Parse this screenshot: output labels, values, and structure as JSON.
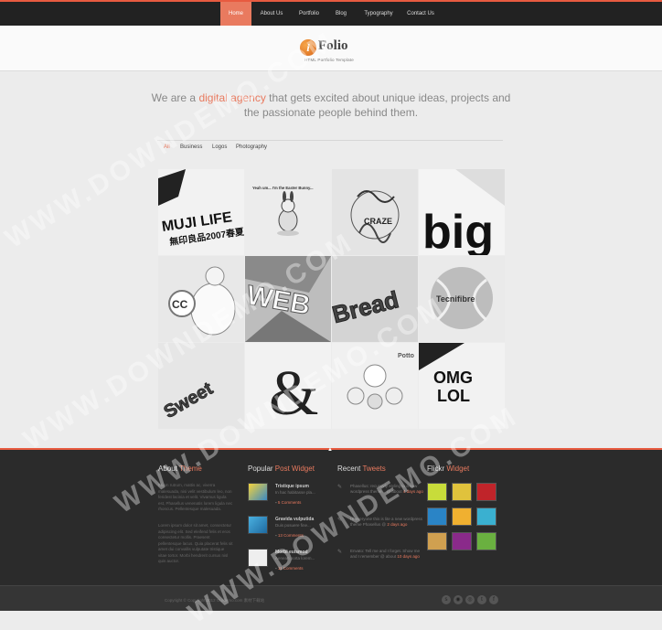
{
  "nav": {
    "items": [
      "Home",
      "About Us",
      "Portfolio",
      "Blog",
      "Typography",
      "Contact Us"
    ],
    "active": 0
  },
  "brand": {
    "logo_letter": "i",
    "name": "Folio",
    "tagline": "HTML Portfolio Template"
  },
  "intro": {
    "before": "We are a ",
    "highlight": "digital agency",
    "after": " that gets excited about unique ideas, projects and the passionate people behind them."
  },
  "filters": {
    "items": [
      "All",
      "Business",
      "Logos",
      "Photography"
    ],
    "active": 0
  },
  "portfolio": {
    "tiles": [
      {
        "name": "muji-life",
        "text": "MUJI LIFE",
        "sub": "無印良品2007春夏"
      },
      {
        "name": "easter-bunny",
        "text": "Yeah um... I'm the Easter Bunny..."
      },
      {
        "name": "craze-illustration",
        "text": "CRAZE"
      },
      {
        "name": "big-type",
        "text": "big"
      },
      {
        "name": "cc-monster",
        "text": "CC"
      },
      {
        "name": "web-3d",
        "text": "WEB"
      },
      {
        "name": "bread-3d",
        "text": "Bread"
      },
      {
        "name": "tennis-ball",
        "text": "Tecnifibre"
      },
      {
        "name": "sweet-type",
        "text": "Sweet"
      },
      {
        "name": "ampersand",
        "text": "&"
      },
      {
        "name": "toys",
        "text": "Potto"
      },
      {
        "name": "omg-lol",
        "text": "OMG",
        "sub": "LOL"
      }
    ]
  },
  "footer": {
    "about": {
      "title_a": "About ",
      "title_b": "Theme",
      "p1": "Etiam rutrum, mattis ac, viverra malesuada, nisi velit vestibulum leo, non feridest lacinia et velit. Vivamus ligula est, Phasellus venenatis lorem ligula nec rhoncus. Pellentesque malesuada.",
      "p2": "Lorem ipsum dolor sit amet, consectetur adipiscing elit. Sed eleifend felis et eros consectetur mollis. Praesent pellentesque lacus. Quia placerat felis sit amet dui convallis vulputate tristique vitae tortor. Morbi hendrerit cursus nisl quis auctor."
    },
    "popular": {
      "title_a": "Popular ",
      "title_b": "Post Widget",
      "posts": [
        {
          "title": "Tristique ipsum",
          "excerpt": "In hac habitasse pla...",
          "meta": "5 Comments"
        },
        {
          "title": "Gravida vulputida",
          "excerpt": "Duis posuere fine...",
          "meta": "13 Comments"
        },
        {
          "title": "Morbi euismod",
          "excerpt": "Aenean porta lorem...",
          "meta": "11 Comments"
        }
      ]
    },
    "tweets": {
      "title_a": "Recent ",
      "title_b": "Tweets",
      "items": [
        {
          "text": "Phasellus: recursivly styling to a new wordpress theme... @ about",
          "time": "4 days ago"
        },
        {
          "text": "Hi everyone this is lite a new wordpress theme Phasellus @",
          "time": "2 days ago"
        },
        {
          "text": "Envato: Tell me and I forget. Show me and I remember @ about",
          "time": "10 days ago"
        }
      ]
    },
    "flickr": {
      "title_a": "Flickr ",
      "title_b": "Widget",
      "colors": [
        "#c8dc3a",
        "#e0c23c",
        "#c0242a",
        "#2a84c6",
        "#f0b030",
        "#3ab0d0",
        "#d0a050",
        "#8a2a8a",
        "#6ab040"
      ]
    },
    "copyright": "Copyright © Copyright 2012 Ourdemo.com 素材下载站",
    "social": [
      "skype",
      "rss",
      "dribbble",
      "twitter",
      "facebook"
    ]
  },
  "watermark": "WWW.DOWNDEMO.COM"
}
